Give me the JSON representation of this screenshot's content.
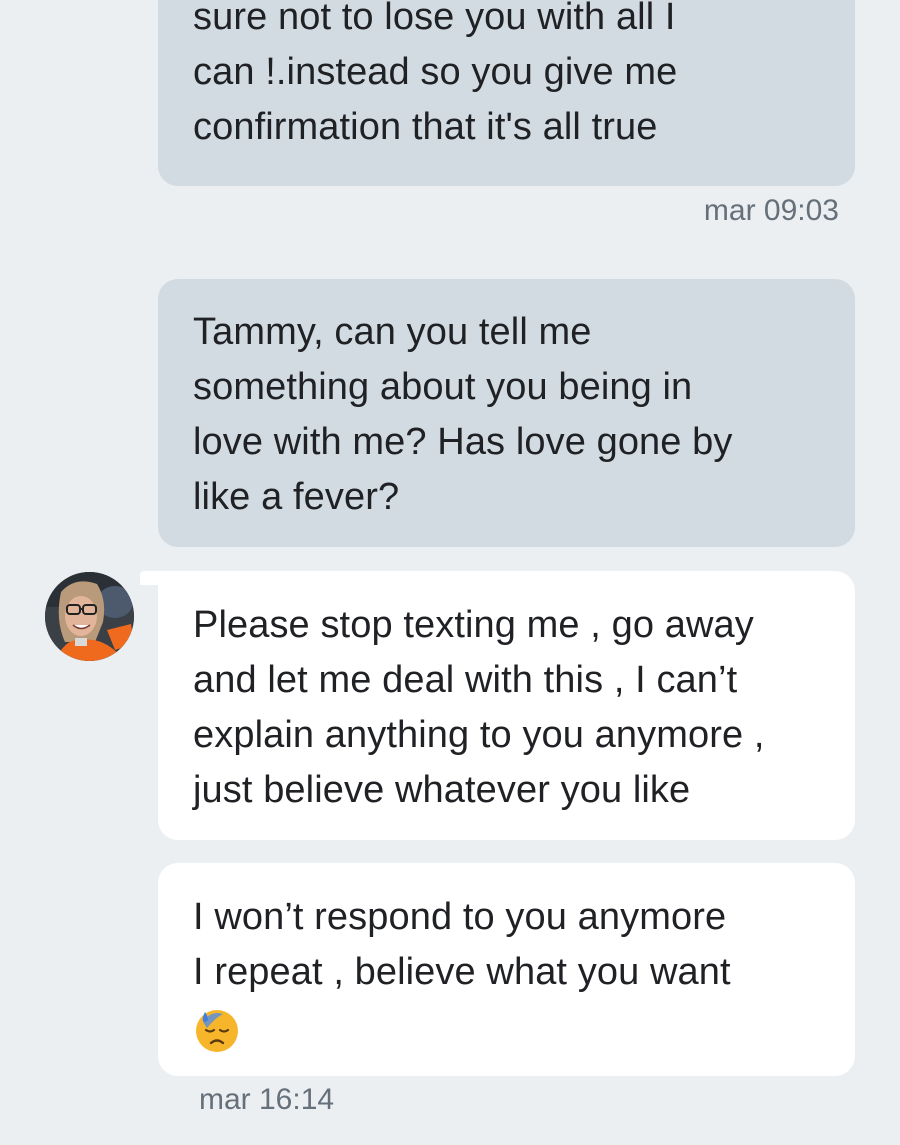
{
  "conversation": {
    "messages": [
      {
        "direction": "outgoing",
        "lines": [
          "sure not to lose you with all I",
          "can !.instead so you give me",
          "confirmation that it's all true"
        ]
      },
      {
        "direction": "outgoing",
        "lines": [
          "Tammy, can you tell me",
          "something about you being in",
          "love with me? Has love gone by",
          "like a fever?"
        ]
      },
      {
        "direction": "incoming",
        "lines": [
          "Please stop texting me , go away",
          "and let me deal with this , I can’t",
          "explain anything to you anymore ,",
          "just believe whatever you like"
        ]
      },
      {
        "direction": "incoming",
        "lines": [
          "I won’t respond to you anymore",
          "I repeat , believe what you want"
        ],
        "emoji": "sad-sweat-face-emoji"
      }
    ],
    "timestamps": {
      "outgoing": "mar 09:03",
      "incoming": "mar 16:14"
    },
    "contact_avatar": "contact-photo-avatar"
  },
  "colors": {
    "background": "#ebeff2",
    "outgoing_bubble": "#d1dbe1",
    "incoming_bubble": "#ffffff",
    "text": "#1f2124",
    "timestamp": "#66707a"
  }
}
